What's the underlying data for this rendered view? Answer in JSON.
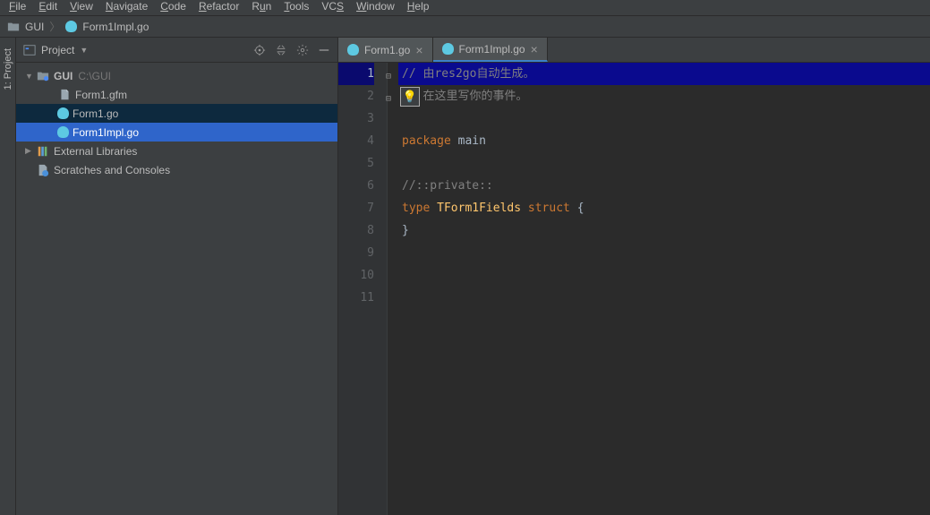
{
  "menubar": {
    "items": [
      "File",
      "Edit",
      "View",
      "Navigate",
      "Code",
      "Refactor",
      "Run",
      "Tools",
      "VCS",
      "Window",
      "Help"
    ]
  },
  "navbar": {
    "project": "GUI",
    "file": "Form1Impl.go"
  },
  "vertical_tab": {
    "label": "1: Project"
  },
  "project_panel": {
    "title": "Project",
    "tree": {
      "root": {
        "name": "GUI",
        "path": "C:\\GUI"
      },
      "files": [
        {
          "name": "Form1.gfm",
          "type": "gfm"
        },
        {
          "name": "Form1.go",
          "type": "go"
        },
        {
          "name": "Form1Impl.go",
          "type": "go",
          "selected": true
        }
      ],
      "extra": [
        {
          "name": "External Libraries",
          "icon": "lib"
        },
        {
          "name": "Scratches and Consoles",
          "icon": "scratch"
        }
      ]
    }
  },
  "editor": {
    "tabs": [
      {
        "label": "Form1.go",
        "active": false
      },
      {
        "label": "Form1Impl.go",
        "active": true
      }
    ],
    "code": {
      "line1": "// 由res2go自动生成。",
      "line2": "// 在这里写你的事件。",
      "line3": "",
      "line4_kw": "package",
      "line4_pkg": "main",
      "line5": "",
      "line6": "//::private::",
      "line7_kw1": "type",
      "line7_id": "TForm1Fields",
      "line7_kw2": "struct",
      "line7_brace": "{",
      "line8": "}",
      "line9": "",
      "line10": "",
      "line11": ""
    },
    "line_count": 11
  }
}
